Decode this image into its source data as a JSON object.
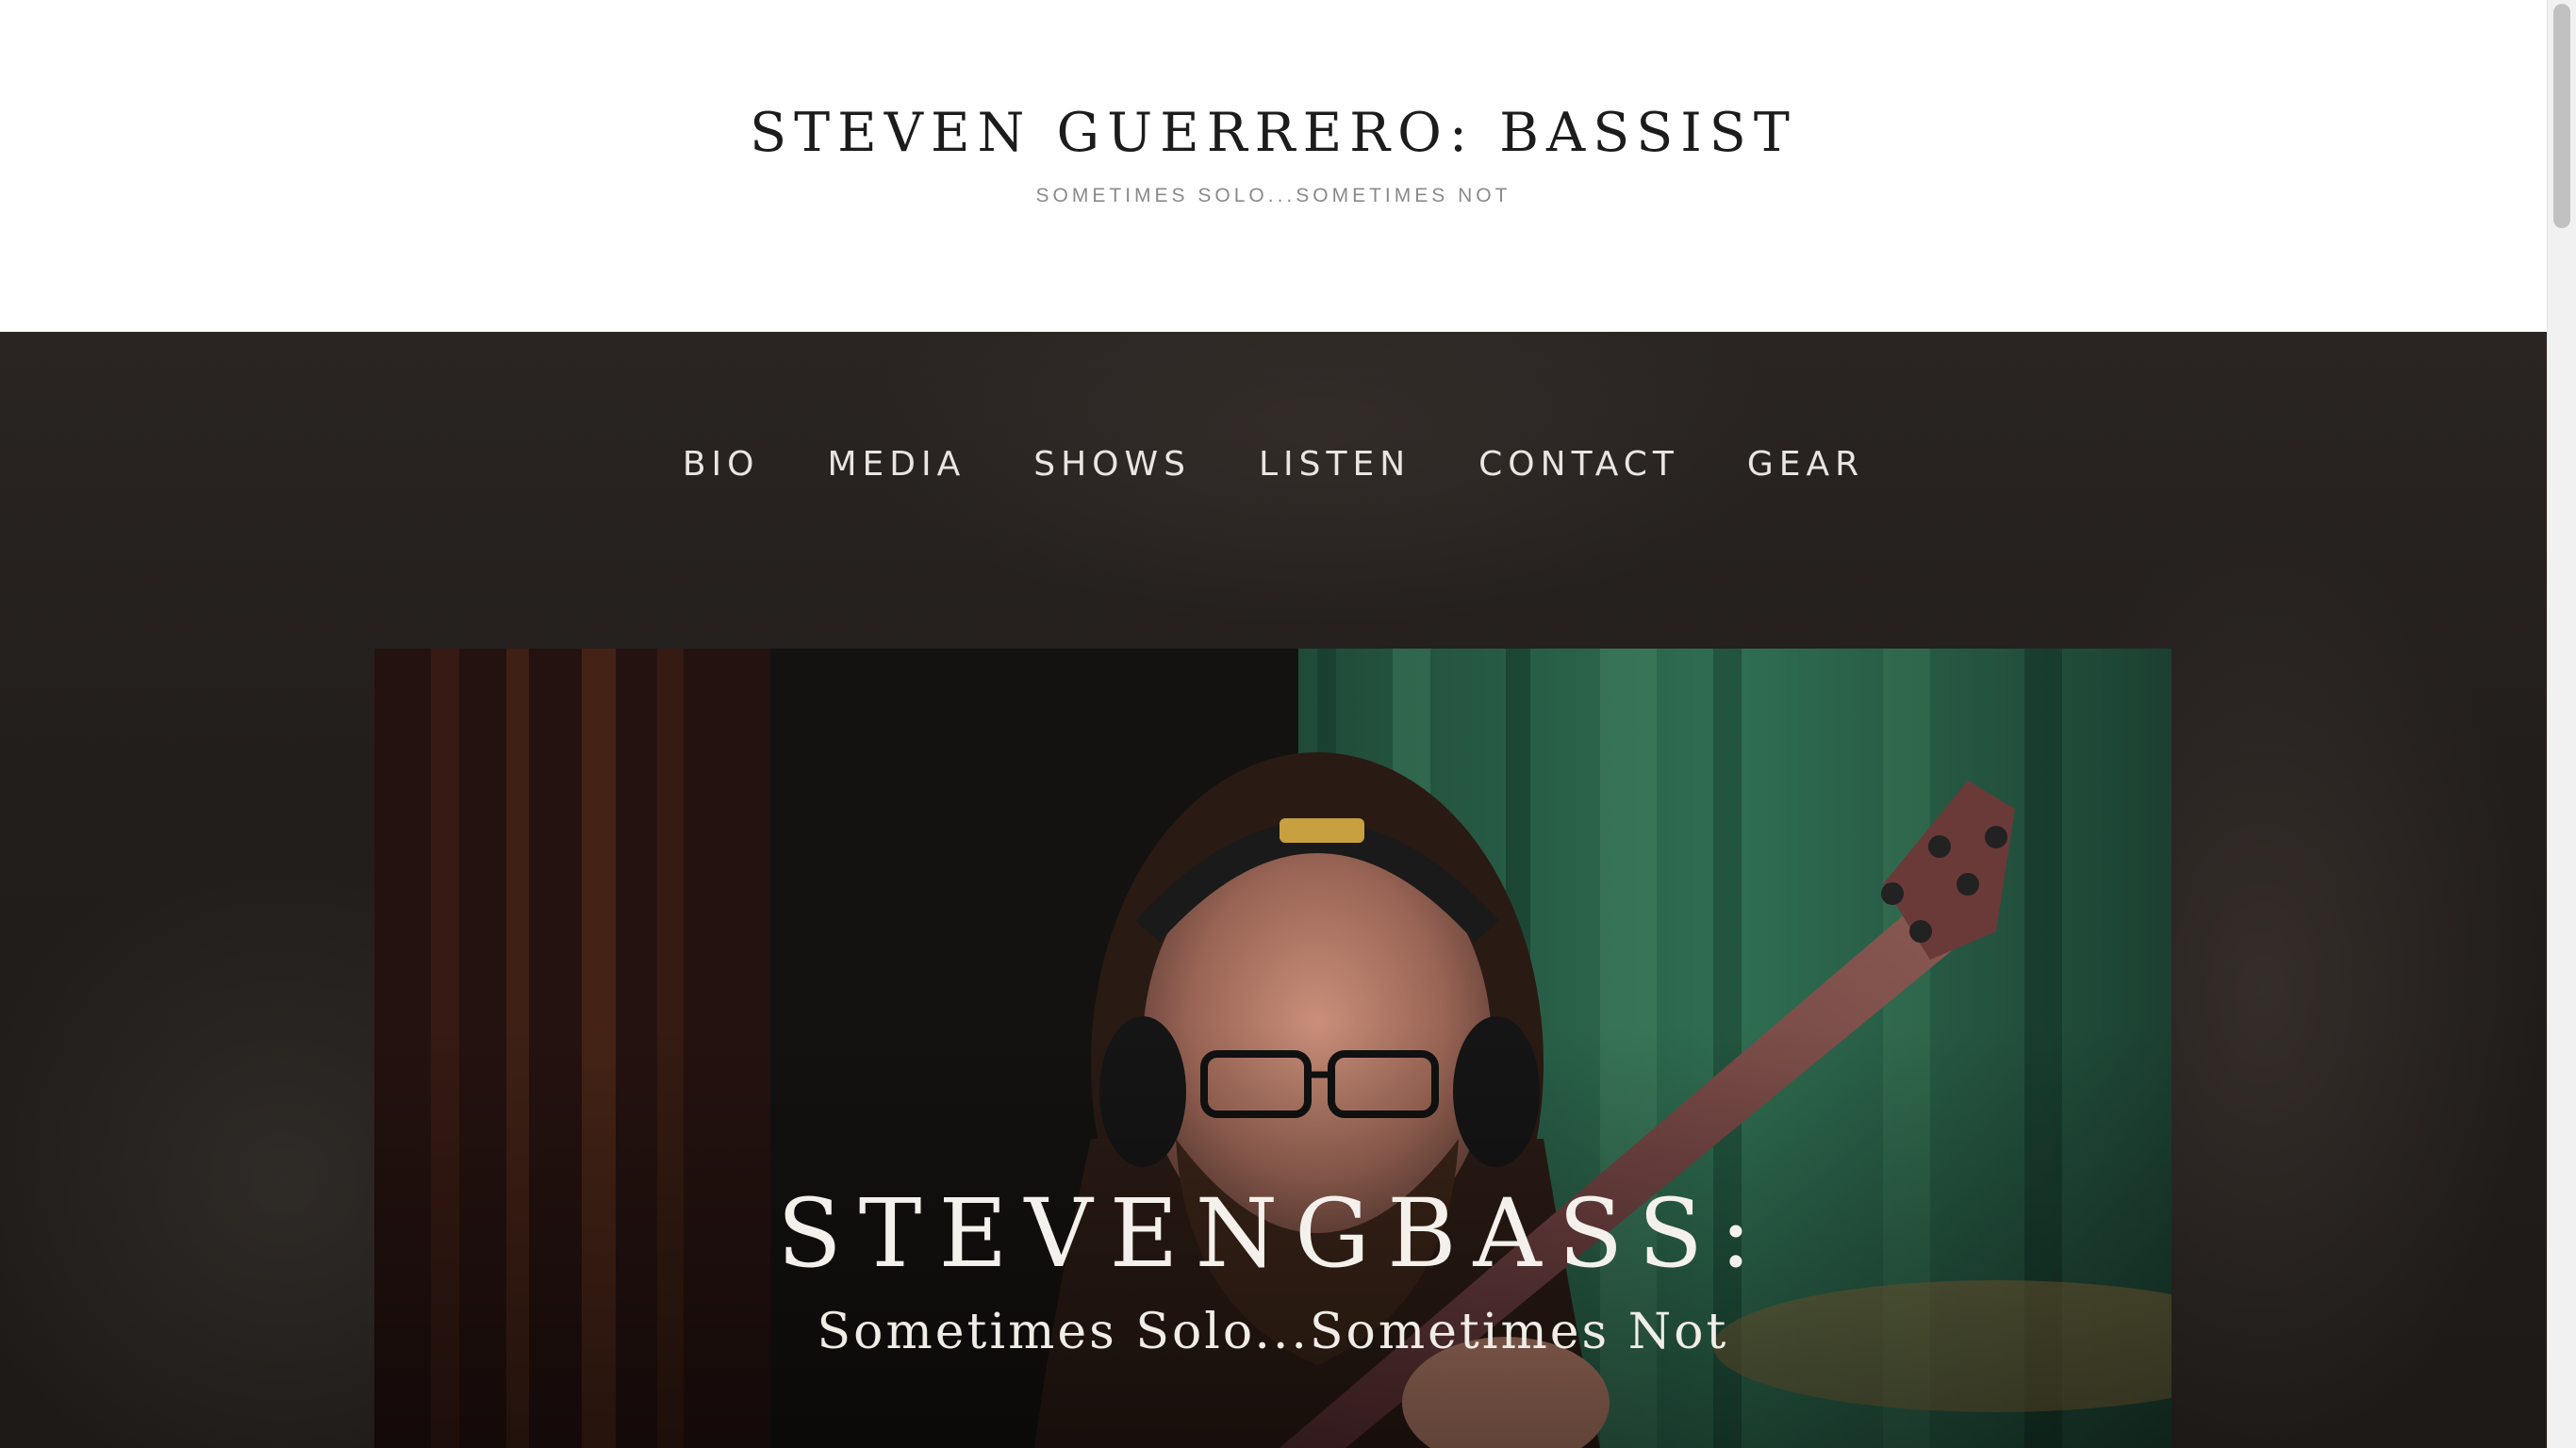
{
  "header": {
    "site_title": "STEVEN GUERRERO: BASSIST",
    "tagline": "SOMETIMES SOLO...SOMETIMES NOT"
  },
  "nav": {
    "items": [
      {
        "label": "BIO"
      },
      {
        "label": "MEDIA"
      },
      {
        "label": "SHOWS"
      },
      {
        "label": "LISTEN"
      },
      {
        "label": "CONTACT"
      },
      {
        "label": "GEAR"
      }
    ]
  },
  "hero": {
    "heading": "STEVENGBASS:",
    "subheading": "Sometimes Solo...Sometimes Not",
    "image_alt": "bassist-photo"
  },
  "colors": {
    "header_bg": "#ffffff",
    "band_bg": "#241f1d",
    "nav_text": "#e9e6e2",
    "title_text": "#1c1c1c",
    "tagline_text": "#8a8a8a"
  }
}
